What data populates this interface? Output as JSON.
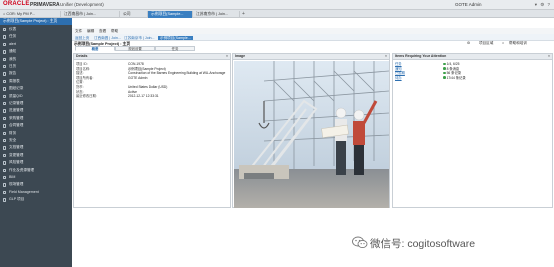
{
  "app": {
    "logo_text": "ORACLE",
    "product_text": "PRIMAVERA",
    "environment_text": "Unifier (Development)",
    "user_label": "GOTE Admin",
    "brand_colors": {
      "logo": "#d0021b",
      "accent": "#3a7fc1",
      "sidebar": "#3c4852"
    }
  },
  "tabs": [
    {
      "label": "COR: My PM P...",
      "icon": "home-icon"
    },
    {
      "label": "江西南昌市 | Join...",
      "icon": ""
    },
    {
      "label": "公司",
      "icon": ""
    },
    {
      "label": "示例项目(Sample...",
      "icon": "",
      "active": true
    },
    {
      "label": "江苏南京市 | Join...",
      "icon": ""
    }
  ],
  "tab_add_label": "+",
  "sidebar": {
    "header": "示例项目(Sample Project) : 主页",
    "items": [
      {
        "label": "仪表",
        "icon": "dashboard-icon"
      },
      {
        "label": "任务",
        "icon": "task-icon"
      },
      {
        "label": "alert",
        "icon": "alert-icon"
      },
      {
        "label": "通知",
        "icon": "bell-icon"
      },
      {
        "label": "我的",
        "icon": "user-icon"
      },
      {
        "label": "日历",
        "icon": "calendar-icon"
      },
      {
        "label": "报告",
        "icon": "report-icon"
      },
      {
        "label": "周报表",
        "icon": "report-icon"
      },
      {
        "label": "图纸记录",
        "icon": "drawing-icon"
      },
      {
        "label": "质量Q/D",
        "icon": "quality-icon"
      },
      {
        "label": "记录管理",
        "icon": "record-icon"
      },
      {
        "label": "进度管理",
        "icon": "schedule-icon"
      },
      {
        "label": "采购管理",
        "icon": "cart-icon"
      },
      {
        "label": "合同管理",
        "icon": "contract-icon"
      },
      {
        "label": "财务",
        "icon": "money-icon"
      },
      {
        "label": "安全",
        "icon": "shield-icon"
      },
      {
        "label": "文档管理",
        "icon": "folder-icon"
      },
      {
        "label": "变更管理",
        "icon": "change-icon"
      },
      {
        "label": "风险管理",
        "icon": "risk-icon"
      },
      {
        "label": "作业及资源管理",
        "icon": "resource-icon"
      },
      {
        "label": "BIM",
        "icon": "cube-icon"
      },
      {
        "label": "现场管理",
        "icon": "site-icon"
      },
      {
        "label": "Field Management",
        "icon": "field-icon"
      },
      {
        "label": "GLP 项目",
        "icon": "project-icon"
      }
    ]
  },
  "menu": [
    "文件",
    "编辑",
    "查看",
    "帮助"
  ],
  "breadcrumb": [
    "返回上页",
    "江西南昌 | Join...",
    "江苏南京市 | Join...",
    "示例项目(Sample..."
  ],
  "project_title": "示例项目(Sample Project) : 主页",
  "toolbar": {
    "gear": "⚙",
    "projects": "项目区域",
    "help": "帮助和培训"
  },
  "subtabs": [
    "概要",
    "规划设置",
    "任务"
  ],
  "details": {
    "title": "Details",
    "rows": [
      {
        "label": "项目 ID:",
        "value": "CON-1978"
      },
      {
        "label": "项目名称:",
        "value": "示例项目(Sample Project)"
      },
      {
        "label": "描述:",
        "value": "Construction of the Barnes Engineering Building at WU-Anchorage"
      },
      {
        "label": "项目所有者:",
        "value": "GOTE Admin"
      },
      {
        "label": "位置:",
        "value": ""
      },
      {
        "label": "货币:",
        "value": "United States Dollar (USD)"
      },
      {
        "label": "状态:",
        "value": "Active"
      },
      {
        "label": "最近修改日期:",
        "value": "2012-12-17 12:33:31"
      }
    ]
  },
  "image_panel": {
    "title": "Image"
  },
  "situation": {
    "title": "Items Requiring Your Attention",
    "rows": [
      {
        "label": "任务",
        "value": "1/4, 6/25"
      },
      {
        "label": "通知",
        "value": "8 条消息"
      },
      {
        "label": "已逾期",
        "value": "56 条记录"
      },
      {
        "label": "待办",
        "value": "17/44 条记录"
      }
    ]
  },
  "watermark_text": "微信号: cogitosoftware"
}
